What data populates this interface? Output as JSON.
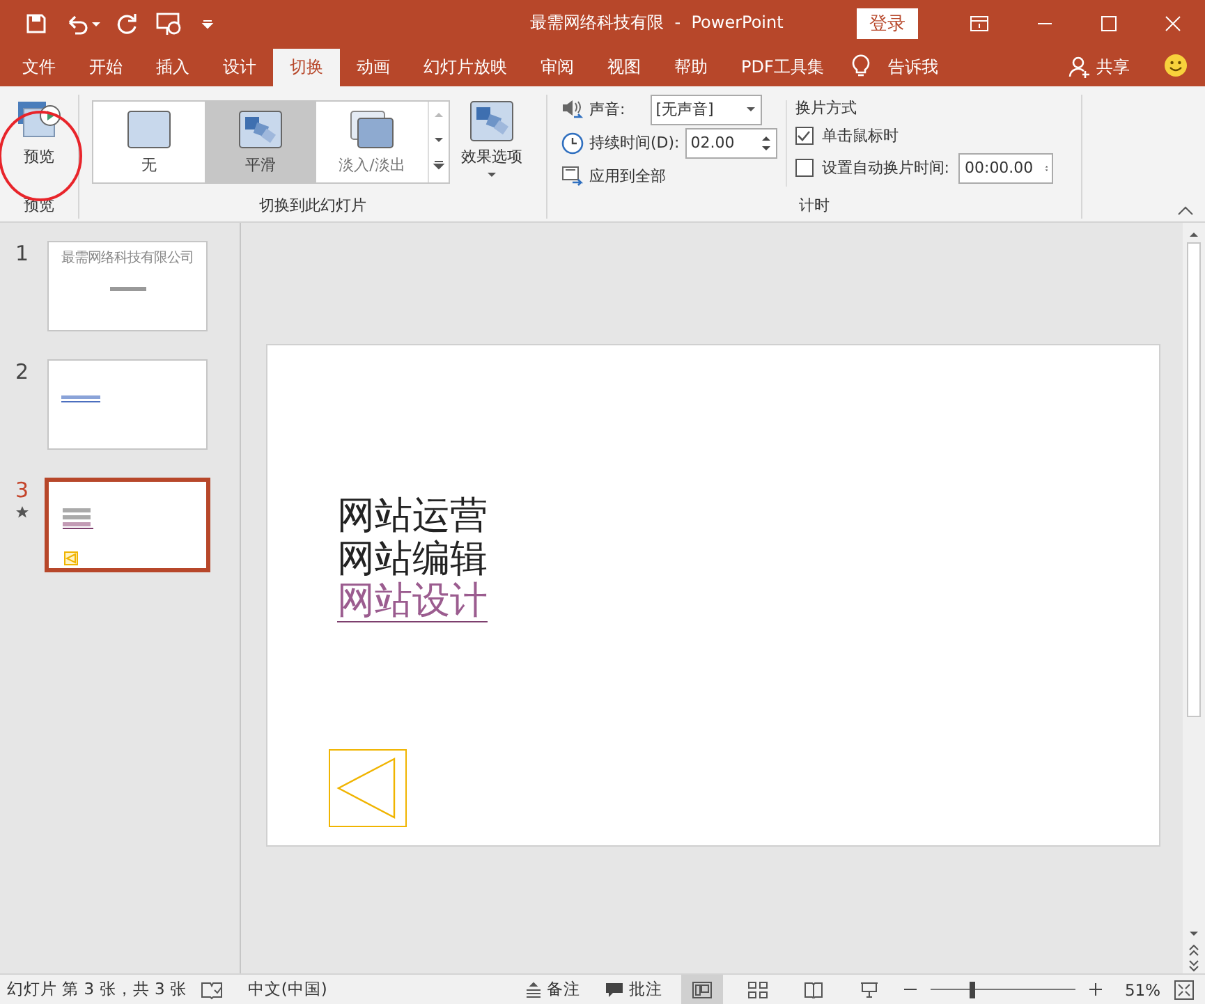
{
  "window": {
    "title": "最需网络科技有限  -  PowerPoint",
    "sign_in": "登录"
  },
  "tabs": [
    {
      "label": "文件",
      "selected": false
    },
    {
      "label": "开始",
      "selected": false
    },
    {
      "label": "插入",
      "selected": false
    },
    {
      "label": "设计",
      "selected": false
    },
    {
      "label": "切换",
      "selected": true
    },
    {
      "label": "动画",
      "selected": false
    },
    {
      "label": "幻灯片放映",
      "selected": false
    },
    {
      "label": "审阅",
      "selected": false
    },
    {
      "label": "视图",
      "selected": false
    },
    {
      "label": "帮助",
      "selected": false
    },
    {
      "label": "PDF工具集",
      "selected": false
    }
  ],
  "tell_me": "告诉我",
  "share": "共享",
  "ribbon": {
    "preview_button": "预览",
    "preview_group": "预览",
    "transitions": [
      {
        "label": "无",
        "kind": "none",
        "selected": false
      },
      {
        "label": "平滑",
        "kind": "morph",
        "selected": true
      },
      {
        "label": "淡入/淡出",
        "kind": "fade",
        "selected": false
      }
    ],
    "effect_options": "效果选项",
    "transitions_group": "切换到此幻灯片",
    "sound_label": "声音:",
    "sound_value": "[无声音]",
    "duration_label": "持续时间(D):",
    "duration_value": "02.00",
    "apply_all": "应用到全部",
    "advance_heading": "换片方式",
    "advance_options": [
      {
        "label": "单击鼠标时",
        "checked": true
      },
      {
        "label": "设置自动换片时间:",
        "checked": false,
        "value": "00:00.00"
      }
    ],
    "timing_group": "计时"
  },
  "slides": [
    {
      "number": "1",
      "selected": false,
      "animated": false,
      "kind": "title",
      "title": "最需网络科技有限公司"
    },
    {
      "number": "2",
      "selected": false,
      "animated": false,
      "kind": "link"
    },
    {
      "number": "3",
      "selected": true,
      "animated": true,
      "kind": "list"
    }
  ],
  "slide": {
    "lines": [
      {
        "text": "网站运营",
        "kind": "text"
      },
      {
        "text": "网站编辑",
        "kind": "text"
      },
      {
        "text": "网站设计",
        "kind": "link"
      }
    ]
  },
  "status_bar": {
    "slide_info": "幻灯片 第 3 张，共 3 张",
    "language": "中文(中国)",
    "notes": "备注",
    "comments": "批注",
    "views": [
      {
        "kind": "normal",
        "selected": true
      },
      {
        "kind": "sorter",
        "selected": false
      },
      {
        "kind": "reading",
        "selected": false
      },
      {
        "kind": "show",
        "selected": false
      }
    ],
    "zoom": {
      "level": 0.28,
      "reading": "51%"
    }
  }
}
